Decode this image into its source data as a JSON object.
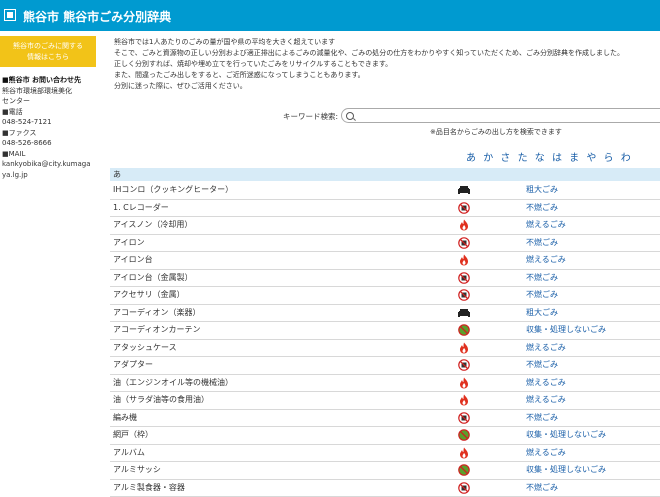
{
  "header": {
    "title": "熊谷市 熊谷市ごみ分別辞典"
  },
  "sidebar": {
    "banner": "熊谷市のごみに関する\n情報はこちら",
    "contact_heading": "■熊谷市 お問い合わせ先",
    "lines": [
      "熊谷市環境部環境美化",
      "センター",
      "■電話",
      "048-524-7121",
      "■ファクス",
      "048-526-8666",
      "■MAIL",
      "kankyobika@city.kumaga",
      "ya.lg.jp"
    ]
  },
  "intro": [
    "熊谷市では1人あたりのごみの量が国や県の平均を大きく超えています",
    "そこで、ごみと資源物の正しい分別および適正排出によるごみの減量化や、ごみの処分の仕方をわかりやすく知っていただくため、ごみ分別辞典を作成しました。",
    "正しく分別すれば、焼却や埋め立てを行っていたごみをリサイクルすることもできます。",
    "また、間違ったごみ出しをすると、ご近所迷惑になってしまうこともあります。",
    "分別に迷った際に、ぜひご活用ください。"
  ],
  "search": {
    "label": "キーワード検索:",
    "placeholder": "",
    "note": "※品目名からごみの出し方を検索できます"
  },
  "kana": [
    "あ",
    "か",
    "さ",
    "た",
    "な",
    "は",
    "ま",
    "や",
    "ら",
    "わ"
  ],
  "list": {
    "section": "あ",
    "rows": [
      {
        "name": "IHコンロ（クッキングヒーター）",
        "icon": "sofa-icon",
        "category": "粗大ごみ"
      },
      {
        "name": "1. Cレコーダー",
        "icon": "no-burn-icon",
        "category": "不燃ごみ"
      },
      {
        "name": "アイスノン（冷却用）",
        "icon": "fire-icon",
        "category": "燃えるごみ"
      },
      {
        "name": "アイロン",
        "icon": "no-burn-icon",
        "category": "不燃ごみ"
      },
      {
        "name": "アイロン台",
        "icon": "fire-icon",
        "category": "燃えるごみ"
      },
      {
        "name": "アイロン台（金属製）",
        "icon": "no-burn-icon",
        "category": "不燃ごみ"
      },
      {
        "name": "アクセサリ（金属）",
        "icon": "no-burn-icon",
        "category": "不燃ごみ"
      },
      {
        "name": "アコーディオン（楽器）",
        "icon": "sofa-icon",
        "category": "粗大ごみ"
      },
      {
        "name": "アコーディオンカーテン",
        "icon": "no-collect-icon",
        "category": "収集・処理しないごみ"
      },
      {
        "name": "アタッシュケース",
        "icon": "fire-icon",
        "category": "燃えるごみ"
      },
      {
        "name": "アダプター",
        "icon": "no-burn-icon",
        "category": "不燃ごみ"
      },
      {
        "name": "油（エンジンオイル等の機械油）",
        "icon": "fire-icon",
        "category": "燃えるごみ"
      },
      {
        "name": "油（サラダ油等の食用油）",
        "icon": "fire-icon",
        "category": "燃えるごみ"
      },
      {
        "name": "編み機",
        "icon": "no-burn-icon",
        "category": "不燃ごみ"
      },
      {
        "name": "網戸（枠）",
        "icon": "no-collect-icon",
        "category": "収集・処理しないごみ"
      },
      {
        "name": "アルバム",
        "icon": "fire-icon",
        "category": "燃えるごみ"
      },
      {
        "name": "アルミサッシ",
        "icon": "no-collect-icon",
        "category": "収集・処理しないごみ"
      },
      {
        "name": "アルミ製食器・容器",
        "icon": "no-burn-icon",
        "category": "不燃ごみ"
      }
    ]
  },
  "colors": {
    "header": "#009ad0",
    "banner": "#f2c318",
    "section": "#d7ebf7",
    "link": "#1a5fa8"
  }
}
